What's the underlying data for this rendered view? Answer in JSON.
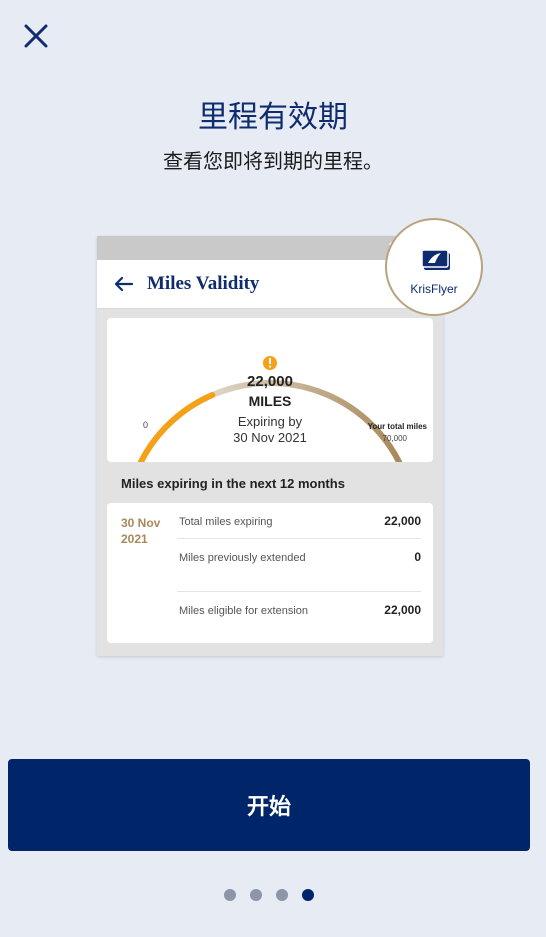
{
  "header": {
    "title": "里程有效期",
    "subtitle": "查看您即将到期的里程。"
  },
  "mockup": {
    "app_title": "Miles Validity",
    "gauge": {
      "value": "22,000",
      "unit": "MILES",
      "expiring_by_label": "Expiring by",
      "expiring_date": "30 Nov 2021",
      "min_label": "0",
      "total_label": "Your total miles",
      "total_value": "70,000",
      "expiring_fraction": 0.314,
      "colors": {
        "expiring": "#f3a118",
        "remaining_start": "#ded6c6",
        "remaining_end": "#a8895a",
        "warning": "#f3a118"
      }
    },
    "section_title": "Miles expiring in the next 12 months",
    "table": {
      "date": "30 Nov 2021",
      "rows": [
        {
          "label": "Total miles expiring",
          "value": "22,000"
        },
        {
          "label": "Miles previously extended",
          "value": "0"
        },
        {
          "label": "Miles eligible for extension",
          "value": "22,000"
        }
      ]
    }
  },
  "badge": {
    "label": "KrisFlyer",
    "icon": "krisflyer-card-icon"
  },
  "start_button": {
    "label": "开始"
  },
  "pagination": {
    "count": 4,
    "active_index": 3
  },
  "colors": {
    "navy": "#002569",
    "background": "#e6ebf4",
    "gold": "#a8895a"
  }
}
